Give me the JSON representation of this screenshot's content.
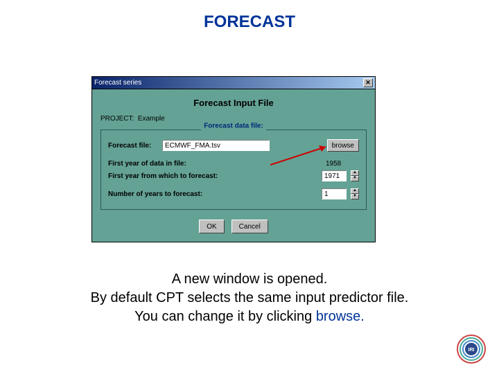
{
  "slide": {
    "title": "FORECAST"
  },
  "dialog": {
    "titlebar": "Forecast series",
    "heading": "Forecast Input File",
    "project_label": "PROJECT:",
    "project_value": "Example",
    "fieldset_legend": "Forecast data file:",
    "file_label": "Forecast file:",
    "file_value": "ECMWF_FMA.tsv",
    "browse_label": "browse",
    "first_year_in_file_label": "First year of data in file:",
    "first_year_in_file_value": "1958",
    "first_year_forecast_label": "First year from which to forecast:",
    "first_year_forecast_value": "1971",
    "num_years_label": "Number of years to forecast:",
    "num_years_value": "1",
    "ok_label": "OK",
    "cancel_label": "Cancel"
  },
  "caption": {
    "line1": "A new window is opened.",
    "line2": "By default CPT selects the same input predictor file.",
    "line3a": "You can change it by clicking ",
    "line3b": "browse.",
    "keyword": "browse"
  },
  "logo_text": "IRI"
}
